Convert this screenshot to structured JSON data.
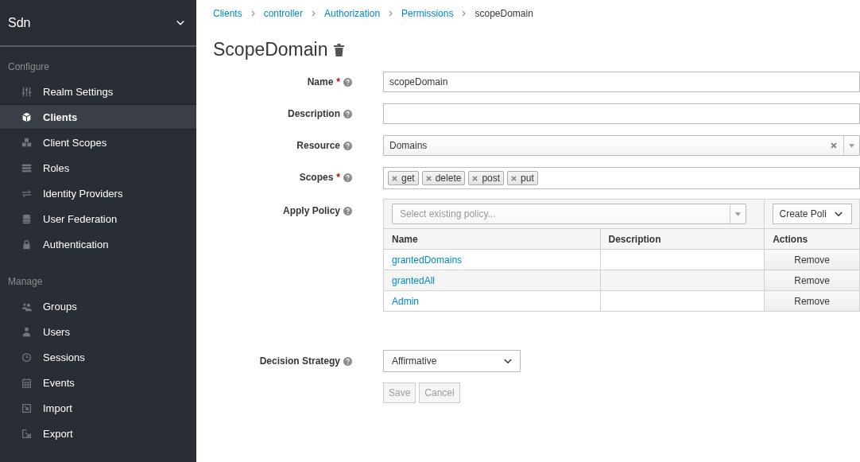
{
  "sidebar": {
    "realm": "Sdn",
    "sections": [
      {
        "title": "Configure",
        "items": [
          {
            "label": "Realm Settings",
            "selected": false
          },
          {
            "label": "Clients",
            "selected": true
          },
          {
            "label": "Client Scopes",
            "selected": false
          },
          {
            "label": "Roles",
            "selected": false
          },
          {
            "label": "Identity Providers",
            "selected": false
          },
          {
            "label": "User Federation",
            "selected": false
          },
          {
            "label": "Authentication",
            "selected": false
          }
        ]
      },
      {
        "title": "Manage",
        "items": [
          {
            "label": "Groups",
            "selected": false
          },
          {
            "label": "Users",
            "selected": false
          },
          {
            "label": "Sessions",
            "selected": false
          },
          {
            "label": "Events",
            "selected": false
          },
          {
            "label": "Import",
            "selected": false
          },
          {
            "label": "Export",
            "selected": false
          }
        ]
      }
    ]
  },
  "breadcrumb": [
    "Clients",
    "controller",
    "Authorization",
    "Permissions",
    "scopeDomain"
  ],
  "title": "ScopeDomain",
  "form": {
    "name": {
      "label": "Name",
      "required_mark": "*",
      "value": "scopeDomain"
    },
    "description": {
      "label": "Description"
    },
    "resource": {
      "label": "Resource",
      "value": "Domains"
    },
    "scopes": {
      "label": "Scopes",
      "required_mark": "*",
      "tags": [
        "get",
        "delete",
        "post",
        "put"
      ]
    },
    "apply_policy": {
      "label": "Apply Policy",
      "placeholder": "Select existing policy...",
      "create_button": "Create Poli",
      "columns": [
        "Name",
        "Description",
        "Actions"
      ],
      "rows": [
        {
          "name": "grantedDomains",
          "action": "Remove"
        },
        {
          "name": "grantedAll",
          "action": "Remove"
        },
        {
          "name": "Admin",
          "action": "Remove"
        }
      ]
    },
    "decision_strategy": {
      "label": "Decision Strategy",
      "value": "Affirmative"
    }
  },
  "buttons": [
    {
      "label": "Save",
      "disabled": true
    },
    {
      "label": "Cancel",
      "disabled": true
    }
  ]
}
